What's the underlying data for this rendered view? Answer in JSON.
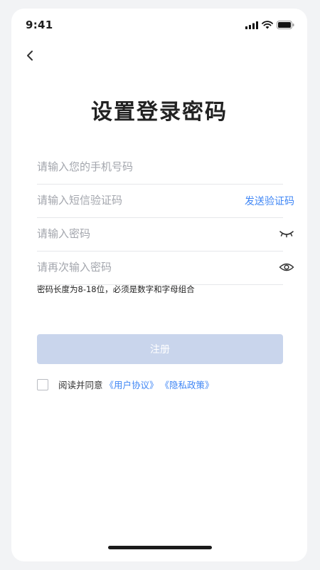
{
  "status_bar": {
    "time": "9:41",
    "icons": [
      "signal-icon",
      "wifi-icon",
      "battery-icon"
    ]
  },
  "header": {
    "back_icon": "chevron-left-icon",
    "title": "设置登录密码"
  },
  "form": {
    "phone": {
      "placeholder": "请输入您的手机号码",
      "value": ""
    },
    "sms_code": {
      "placeholder": "请输入短信验证码",
      "value": "",
      "send_label": "发送验证码"
    },
    "password": {
      "placeholder": "请输入密码",
      "value": "",
      "toggle_icon": "eye-closed-icon"
    },
    "confirm_password": {
      "placeholder": "请再次输入密码",
      "value": "",
      "toggle_icon": "eye-open-icon"
    },
    "hint": "密码长度为8-18位，必须是数字和字母组合"
  },
  "register_button": {
    "label": "注册"
  },
  "agreement": {
    "prefix": "阅读并同意",
    "user_agreement": "《用户协议》",
    "privacy_policy": "《隐私政策》",
    "checked": false
  },
  "colors": {
    "accent": "#3f86f5",
    "button_disabled": "#c9d5ec",
    "placeholder": "#a3a6ad",
    "divider": "#e6e7ea"
  }
}
